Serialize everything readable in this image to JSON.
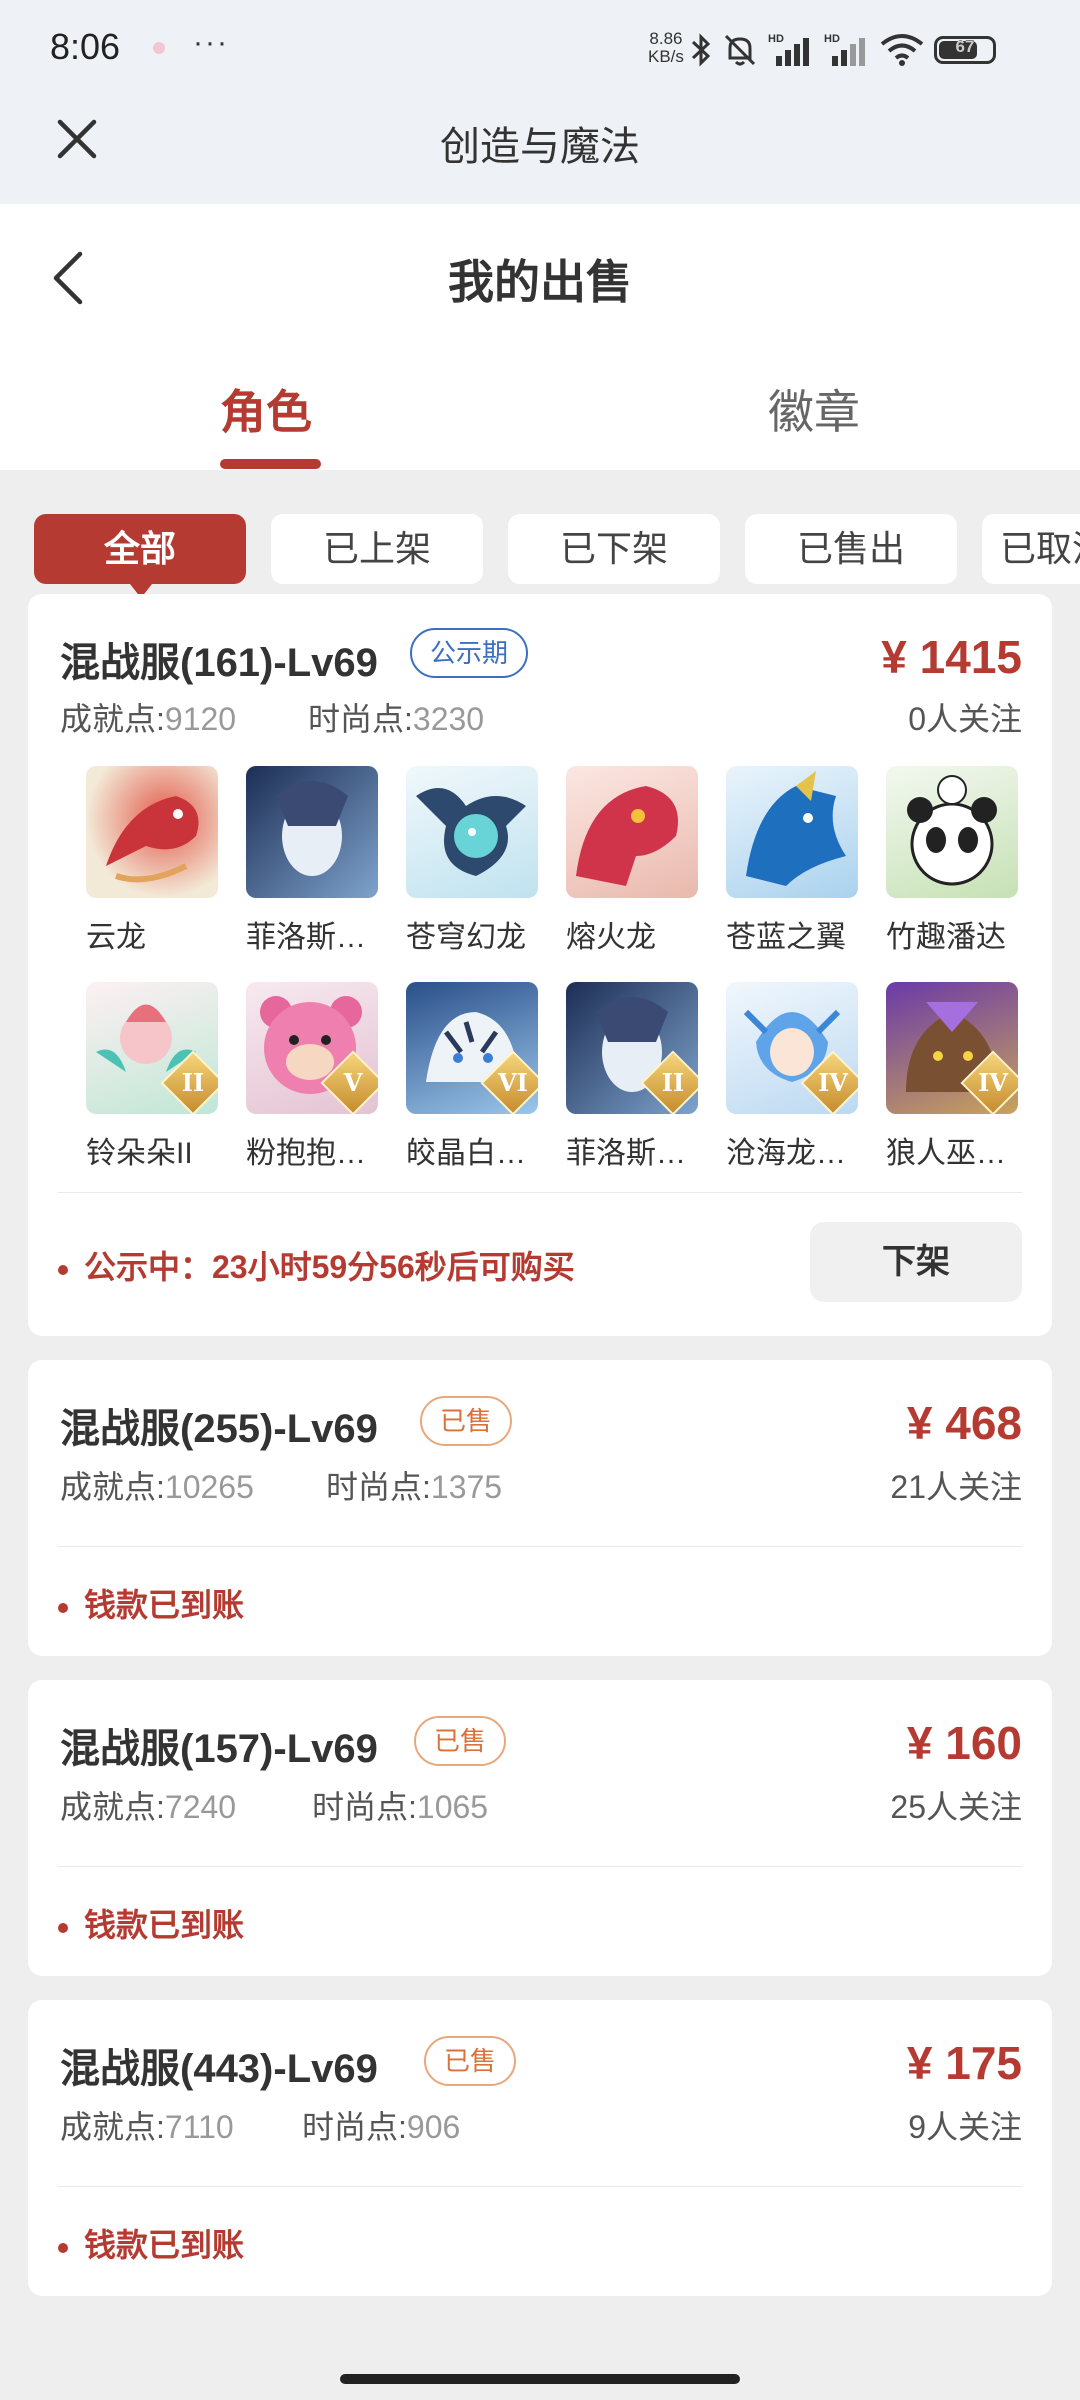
{
  "status": {
    "time": "8:06",
    "more": "···",
    "speed_top": "8.86",
    "speed_bottom": "KB/s",
    "battery": "67",
    "icons": [
      "bluetooth-icon",
      "mute-icon",
      "signal-icon",
      "signal-icon",
      "wifi-icon",
      "battery-icon"
    ]
  },
  "app": {
    "title": "创造与魔法"
  },
  "page": {
    "title": "我的出售"
  },
  "tabs": [
    {
      "label": "角色",
      "active": true
    },
    {
      "label": "徽章",
      "active": false
    }
  ],
  "filters": [
    {
      "label": "全部",
      "active": true
    },
    {
      "label": "已上架"
    },
    {
      "label": "已下架"
    },
    {
      "label": "已售出"
    },
    {
      "label": "已取消"
    }
  ],
  "listings": [
    {
      "title": "混战服(161)-Lv69",
      "badge": "公示期",
      "price": "¥ 1415",
      "achievement_label": "成就点:",
      "achievement": "9120",
      "fashion_label": "时尚点:",
      "fashion": "3230",
      "followers": "0人关注",
      "pets": [
        {
          "name": "云龙",
          "tier": ""
        },
        {
          "name": "菲洛斯…",
          "tier": ""
        },
        {
          "name": "苍穹幻龙",
          "tier": ""
        },
        {
          "name": "熔火龙",
          "tier": ""
        },
        {
          "name": "苍蓝之翼",
          "tier": ""
        },
        {
          "name": "竹趣潘达",
          "tier": ""
        },
        {
          "name": "铃朵朵II",
          "tier": "II"
        },
        {
          "name": "粉抱抱…",
          "tier": "V"
        },
        {
          "name": "皎晶白…",
          "tier": "VI"
        },
        {
          "name": "菲洛斯…",
          "tier": "II"
        },
        {
          "name": "沧海龙…",
          "tier": "IV"
        },
        {
          "name": "狼人巫…",
          "tier": "IV"
        }
      ],
      "note": "公示中：23小时59分56秒后可购买",
      "action": "下架"
    },
    {
      "title": "混战服(255)-Lv69",
      "badge": "已售",
      "price": "¥ 468",
      "achievement_label": "成就点:",
      "achievement": "10265",
      "fashion_label": "时尚点:",
      "fashion": "1375",
      "followers": "21人关注",
      "note": "钱款已到账"
    },
    {
      "title": "混战服(157)-Lv69",
      "badge": "已售",
      "price": "¥ 160",
      "achievement_label": "成就点:",
      "achievement": "7240",
      "fashion_label": "时尚点:",
      "fashion": "1065",
      "followers": "25人关注",
      "note": "钱款已到账"
    },
    {
      "title": "混战服(443)-Lv69",
      "badge": "已售",
      "price": "¥ 175",
      "achievement_label": "成就点:",
      "achievement": "7110",
      "fashion_label": "时尚点:",
      "fashion": "906",
      "followers": "9人关注",
      "note": "钱款已到账"
    }
  ],
  "colors": {
    "accent": "#b53b32",
    "badge_blue": "#3b6fc4",
    "badge_orange": "#d9713a"
  }
}
